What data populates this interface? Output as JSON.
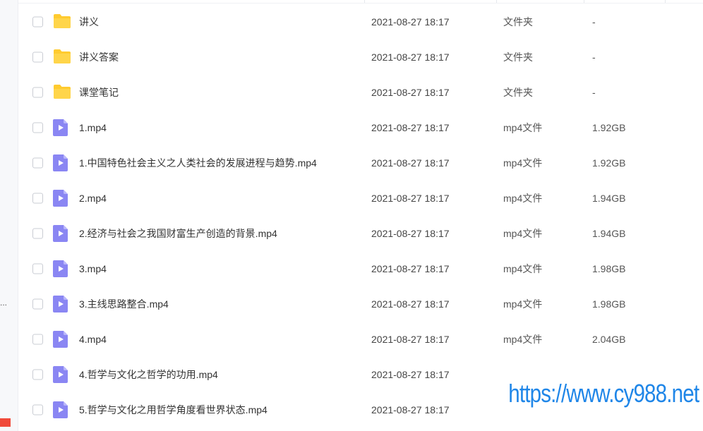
{
  "sidebar": {
    "ellipsis": "..."
  },
  "files": [
    {
      "name": "讲义",
      "date": "2021-08-27 18:17",
      "type": "文件夹",
      "size": "-",
      "icon": "folder-icon"
    },
    {
      "name": "讲义答案",
      "date": "2021-08-27 18:17",
      "type": "文件夹",
      "size": "-",
      "icon": "folder-icon"
    },
    {
      "name": "课堂笔记",
      "date": "2021-08-27 18:17",
      "type": "文件夹",
      "size": "-",
      "icon": "folder-icon"
    },
    {
      "name": "1.mp4",
      "date": "2021-08-27 18:17",
      "type": "mp4文件",
      "size": "1.92GB",
      "icon": "video-file-icon"
    },
    {
      "name": "1.中国特色社会主义之人类社会的发展进程与趋势.mp4",
      "date": "2021-08-27 18:17",
      "type": "mp4文件",
      "size": "1.92GB",
      "icon": "video-file-icon"
    },
    {
      "name": "2.mp4",
      "date": "2021-08-27 18:17",
      "type": "mp4文件",
      "size": "1.94GB",
      "icon": "video-file-icon"
    },
    {
      "name": "2.经济与社会之我国财富生产创造的背景.mp4",
      "date": "2021-08-27 18:17",
      "type": "mp4文件",
      "size": "1.94GB",
      "icon": "video-file-icon"
    },
    {
      "name": "3.mp4",
      "date": "2021-08-27 18:17",
      "type": "mp4文件",
      "size": "1.98GB",
      "icon": "video-file-icon"
    },
    {
      "name": "3.主线思路整合.mp4",
      "date": "2021-08-27 18:17",
      "type": "mp4文件",
      "size": "1.98GB",
      "icon": "video-file-icon"
    },
    {
      "name": "4.mp4",
      "date": "2021-08-27 18:17",
      "type": "mp4文件",
      "size": "2.04GB",
      "icon": "video-file-icon"
    },
    {
      "name": "4.哲学与文化之哲学的功用.mp4",
      "date": "2021-08-27 18:17",
      "type": "",
      "size": "",
      "icon": "video-file-icon"
    },
    {
      "name": "5.哲学与文化之用哲学角度看世界状态.mp4",
      "date": "2021-08-27 18:17",
      "type": "",
      "size": "",
      "icon": "video-file-icon"
    }
  ],
  "watermark": "https://www.cy988.net",
  "colors": {
    "folder": "#ffcb2f",
    "video": "#8a86f3",
    "watermark": "#1f86e8"
  }
}
